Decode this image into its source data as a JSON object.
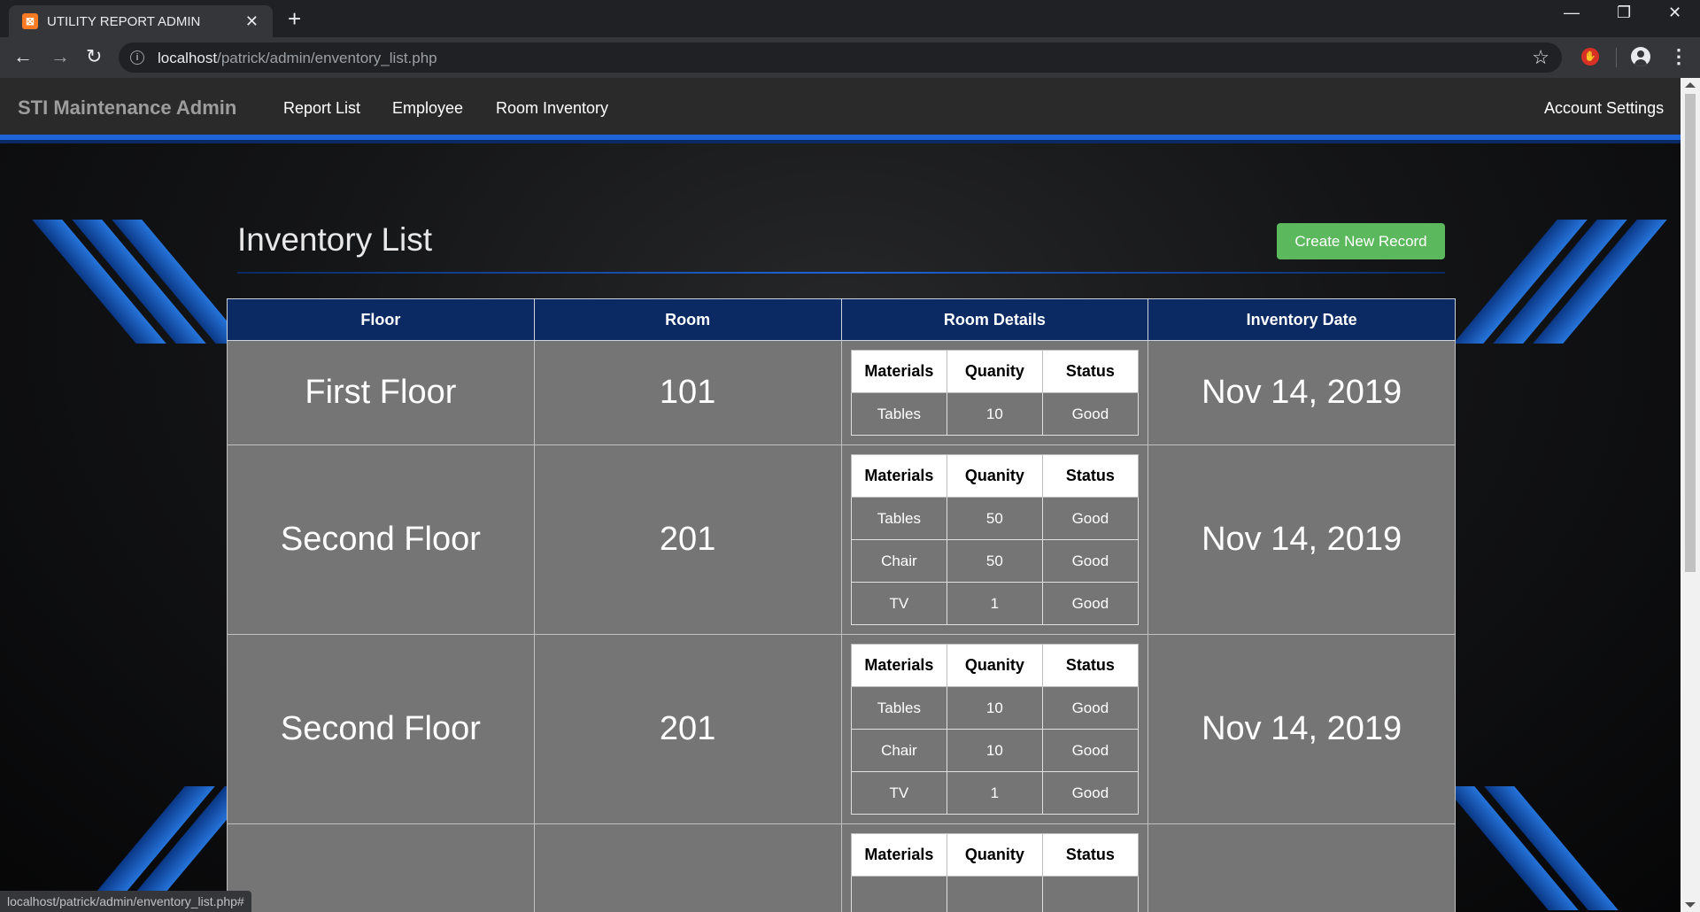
{
  "browser": {
    "tab_title": "UTILITY REPORT ADMIN",
    "tab_favicon": "xampp-icon",
    "url_host": "localhost",
    "url_path": "/patrick/admin/enventory_list.php",
    "status_url": "localhost/patrick/admin/enventory_list.php#"
  },
  "navbar": {
    "brand": "STI Maintenance Admin",
    "links": [
      "Report List",
      "Employee",
      "Room Inventory"
    ],
    "account": "Account Settings"
  },
  "page": {
    "title": "Inventory List",
    "create_button": "Create New Record"
  },
  "table": {
    "headers": [
      "Floor",
      "Room",
      "Room Details",
      "Inventory Date"
    ],
    "detail_headers": [
      "Materials",
      "Quanity",
      "Status"
    ],
    "rows": [
      {
        "floor": "First Floor",
        "room": "101",
        "date": "Nov 14, 2019",
        "details": [
          {
            "material": "Tables",
            "qty": "10",
            "status": "Good"
          }
        ]
      },
      {
        "floor": "Second Floor",
        "room": "201",
        "date": "Nov 14, 2019",
        "details": [
          {
            "material": "Tables",
            "qty": "50",
            "status": "Good"
          },
          {
            "material": "Chair",
            "qty": "50",
            "status": "Good"
          },
          {
            "material": "TV",
            "qty": "1",
            "status": "Good"
          }
        ]
      },
      {
        "floor": "Second Floor",
        "room": "201",
        "date": "Nov 14, 2019",
        "details": [
          {
            "material": "Tables",
            "qty": "10",
            "status": "Good"
          },
          {
            "material": "Chair",
            "qty": "10",
            "status": "Good"
          },
          {
            "material": "TV",
            "qty": "1",
            "status": "Good"
          }
        ]
      }
    ]
  },
  "colors": {
    "navbar_accent": "#1e64d8",
    "table_header": "#0b2a63",
    "row_bg": "#757575",
    "create_button": "#5cb85c"
  }
}
